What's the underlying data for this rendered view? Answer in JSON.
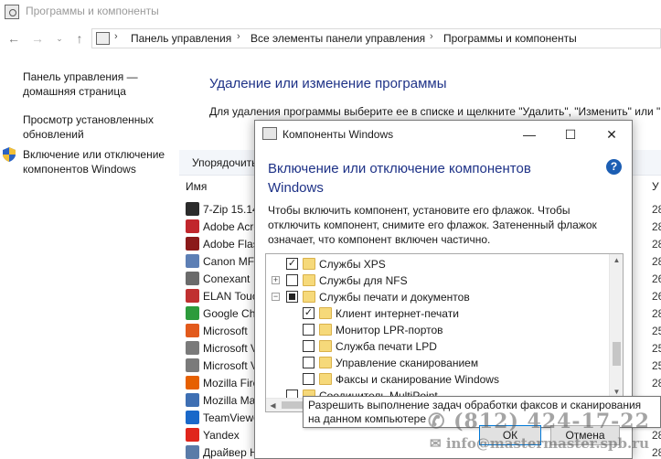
{
  "window": {
    "title": "Программы и компоненты"
  },
  "nav": {
    "breadcrumbs": [
      "Панель управления",
      "Все элементы панели управления",
      "Программы и компоненты"
    ]
  },
  "sidebar": {
    "items": [
      {
        "label_line1": "Панель управления —",
        "label_line2": "домашняя страница"
      },
      {
        "label_line1": "Просмотр установленных",
        "label_line2": "обновлений"
      },
      {
        "label_line1": "Включение или отключение",
        "label_line2": "компонентов Windows"
      }
    ]
  },
  "main": {
    "heading": "Удаление или изменение программы",
    "description": "Для удаления программы выберите ее в списке и щелкните \"Удалить\", \"Изменить\" или \"В",
    "toolbar_label": "Упорядочить",
    "column_name": "Имя",
    "column_date_partial": "У",
    "programs": [
      {
        "name": "7-Zip 15.14",
        "icon_color": "#2b2b2b",
        "date_partial": "28"
      },
      {
        "name": "Adobe Acrobat",
        "icon_color": "#c1272d",
        "date_partial": "28"
      },
      {
        "name": "Adobe Flash",
        "icon_color": "#8b1a1a",
        "date_partial": "28"
      },
      {
        "name": "Canon MF",
        "icon_color": "#5d7fb5",
        "date_partial": "28"
      },
      {
        "name": "Conexant",
        "icon_color": "#6b6b6b",
        "date_partial": "26"
      },
      {
        "name": "ELAN Touch",
        "icon_color": "#c03030",
        "date_partial": "26"
      },
      {
        "name": "Google Chrome",
        "icon_color": "#2d9b3c",
        "date_partial": "28"
      },
      {
        "name": "Microsoft",
        "icon_color": "#e25a1c",
        "date_partial": "25"
      },
      {
        "name": "Microsoft V",
        "icon_color": "#7a7a7a",
        "date_partial": "25"
      },
      {
        "name": "Microsoft V",
        "icon_color": "#7a7a7a",
        "date_partial": "25"
      },
      {
        "name": "Mozilla Firefox",
        "icon_color": "#e66000",
        "date_partial": "28"
      },
      {
        "name": "Mozilla Ma",
        "icon_color": "#3e6fb3",
        "date_partial": "28"
      },
      {
        "name": "TeamViewer",
        "icon_color": "#1a68c9",
        "date_partial": "28"
      },
      {
        "name": "Yandex",
        "icon_color": "#e0261c",
        "date_partial": "28"
      },
      {
        "name": "Драйвер Н",
        "icon_color": "#5a7ba8",
        "date_partial": "28"
      }
    ]
  },
  "dialog": {
    "title": "Компоненты Windows",
    "heading": "Включение или отключение компонентов Windows",
    "description": "Чтобы включить компонент, установите его флажок. Чтобы отключить компонент, снимите его флажок. Затененный флажок означает, что компонент включен частично.",
    "tree": [
      {
        "label": "Службы XPS",
        "state": "checked",
        "level": 0,
        "expander": ""
      },
      {
        "label": "Службы для NFS",
        "state": "unchecked",
        "level": 0,
        "expander": "+"
      },
      {
        "label": "Службы печати и документов",
        "state": "partial",
        "level": 0,
        "expander": "−"
      },
      {
        "label": "Клиент интернет-печати",
        "state": "checked",
        "level": 1,
        "expander": ""
      },
      {
        "label": "Монитор LPR-портов",
        "state": "unchecked",
        "level": 1,
        "expander": ""
      },
      {
        "label": "Служба печати LPD",
        "state": "unchecked",
        "level": 1,
        "expander": ""
      },
      {
        "label": "Управление сканированием",
        "state": "unchecked",
        "level": 1,
        "expander": ""
      },
      {
        "label": "Факсы и сканирование Windows",
        "state": "unchecked",
        "level": 1,
        "expander": ""
      },
      {
        "label": "Соединитель MultiPoint",
        "state": "unchecked",
        "level": 0,
        "expander": ""
      }
    ],
    "tooltip": "Разрешить выполнение задач обработки факсов и сканирования на данном компьютере",
    "ok_label": "ОК",
    "cancel_label": "Отмена",
    "check_mark": "✓"
  },
  "watermark": {
    "phone": "(812) 424-17-22",
    "email": "info@mastermaster.spb.ru"
  },
  "icons": {
    "back": "back-arrow-icon",
    "forward": "forward-arrow-icon",
    "recent": "chevron-down-icon",
    "up": "up-arrow-icon",
    "help": "help-icon",
    "minimize": "minimize-icon",
    "maximize": "maximize-icon",
    "close": "close-icon",
    "shield": "shield-icon",
    "folder": "folder-icon"
  }
}
